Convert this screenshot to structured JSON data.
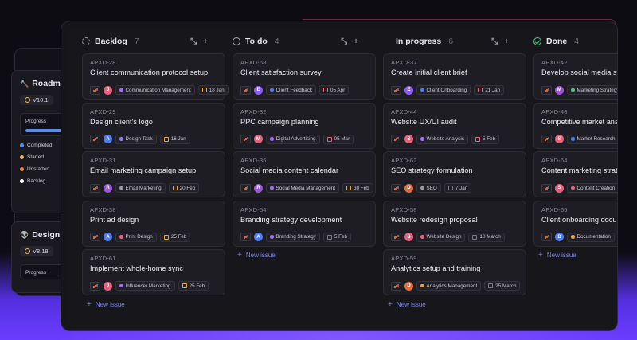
{
  "projects": [
    {
      "name": "Roadmap",
      "version": "V10.1",
      "icon": "hammer-icon"
    },
    {
      "name": "Design",
      "version": "V8.18",
      "icon": "alien-icon"
    }
  ],
  "project_panel": {
    "progress_label": "Progress",
    "legend": [
      {
        "label": "Completed",
        "color": "#5a8cf0"
      },
      {
        "label": "Started",
        "color": "#e6b54a"
      },
      {
        "label": "Unstarted",
        "color": "#e58a33"
      },
      {
        "label": "Backlog",
        "color": "#ffffff"
      }
    ]
  },
  "new_issue_label": "New issue",
  "columns": [
    {
      "name": "Backlog",
      "count": "7",
      "status": "backlog",
      "cards": [
        {
          "id": "APXD-28",
          "title": "Client communication protocol setup",
          "avatar": "J",
          "avatar_color": "#e8607a",
          "tag": "Communication Management",
          "tag_color": "#a56bff",
          "date": "18 Jan",
          "date_color": "#e8a43a"
        },
        {
          "id": "APXD-29",
          "title": "Design client's logo",
          "avatar": "A",
          "avatar_color": "#4d7cf2",
          "tag": "Design Task",
          "tag_color": "#8b7cf5",
          "date": "16 Jan",
          "date_color": "#e8a43a"
        },
        {
          "id": "APXD-31",
          "title": "Email marketing campaign setup",
          "avatar": "R",
          "avatar_color": "#9b56d8",
          "tag": "Email Marketing",
          "tag_color": "#9a98a6",
          "date": "20 Feb",
          "date_color": "#e8a43a"
        },
        {
          "id": "APXD-38",
          "title": "Print ad design",
          "avatar": "A",
          "avatar_color": "#4d7cf2",
          "tag": "Print Design",
          "tag_color": "#e8607a",
          "date": "25 Feb",
          "date_color": "#e8a43a"
        },
        {
          "id": "APXD-61",
          "title": "Implement whole-home sync",
          "avatar": "J",
          "avatar_color": "#e8607a",
          "tag": "Influencer Marketing",
          "tag_color": "#a56bff",
          "date": "25 Feb",
          "date_color": "#e8a43a"
        }
      ]
    },
    {
      "name": "To do",
      "count": "4",
      "status": "todo",
      "cards": [
        {
          "id": "APXD-68",
          "title": "Client satisfaction survey",
          "avatar": "E",
          "avatar_color": "#8b5cf6",
          "tag": "Client Feedback",
          "tag_color": "#4d7cf2",
          "date": "05 Apr",
          "date_color": "#e8607a"
        },
        {
          "id": "APXD-32",
          "title": "PPC campaign planning",
          "avatar": "M",
          "avatar_color": "#e8607a",
          "tag": "Digital Advertising",
          "tag_color": "#a56bff",
          "date": "05 Mar",
          "date_color": "#e8607a"
        },
        {
          "id": "APXD-36",
          "title": "Social media content calendar",
          "avatar": "R",
          "avatar_color": "#9b56d8",
          "tag": "Social Media Management",
          "tag_color": "#a56bff",
          "date": "30 Feb",
          "date_color": "#e8a43a"
        },
        {
          "id": "APXD-54",
          "title": "Branding strategy development",
          "avatar": "A",
          "avatar_color": "#4d7cf2",
          "tag": "Branding Strategy",
          "tag_color": "#a56bff",
          "date": "5 Feb",
          "date_color": "#7d7b88"
        }
      ]
    },
    {
      "name": "In progress",
      "count": "6",
      "status": "progress",
      "cards": [
        {
          "id": "APXD-37",
          "title": "Create initial client brief",
          "avatar": "E",
          "avatar_color": "#8b5cf6",
          "tag": "Client Onboarding",
          "tag_color": "#4d7cf2",
          "date": "21 Jan",
          "date_color": "#e8607a"
        },
        {
          "id": "APXD-44",
          "title": "Website UX/UI audit",
          "avatar": "S",
          "avatar_color": "#e8607a",
          "tag": "Website Analysis",
          "tag_color": "#a56bff",
          "date": "5 Feb",
          "date_color": "#e8607a"
        },
        {
          "id": "APXD-62",
          "title": "SEO strategy formulation",
          "avatar": "D",
          "avatar_color": "#e36d3a",
          "tag": "SEO",
          "tag_color": "#9a98a6",
          "date": "7 Jan",
          "date_color": "#7d7b88"
        },
        {
          "id": "APXD-58",
          "title": "Website redesign proposal",
          "avatar": "S",
          "avatar_color": "#e8607a",
          "tag": "Website Design",
          "tag_color": "#e8607a",
          "date": "10 March",
          "date_color": "#7d7b88"
        },
        {
          "id": "APXD-59",
          "title": "Analytics setup and training",
          "avatar": "D",
          "avatar_color": "#e36d3a",
          "tag": "Analytics Management",
          "tag_color": "#e8a43a",
          "date": "25 March",
          "date_color": "#7d7b88"
        }
      ]
    },
    {
      "name": "Done",
      "count": "4",
      "status": "done",
      "cards": [
        {
          "id": "APXD-42",
          "title": "Develop social media strategy",
          "avatar": "M",
          "avatar_color": "#9b56d8",
          "tag": "Marketing Strategy",
          "tag_color": "#4cc77a",
          "date": "",
          "date_color": ""
        },
        {
          "id": "APXD-48",
          "title": "Competitive market analysis",
          "avatar": "S",
          "avatar_color": "#e8607a",
          "tag": "Market Research",
          "tag_color": "#4d7cf2",
          "date": "",
          "date_color": ""
        },
        {
          "id": "APXD-64",
          "title": "Content marketing strategy",
          "avatar": "S",
          "avatar_color": "#e8607a",
          "tag": "Content Creation",
          "tag_color": "#e8607a",
          "date": "",
          "date_color": ""
        },
        {
          "id": "APXD-65",
          "title": "Client onboarding documentation",
          "avatar": "B",
          "avatar_color": "#4d7cf2",
          "tag": "Documentation",
          "tag_color": "#e8a43a",
          "date": "",
          "date_color": ""
        }
      ]
    }
  ]
}
